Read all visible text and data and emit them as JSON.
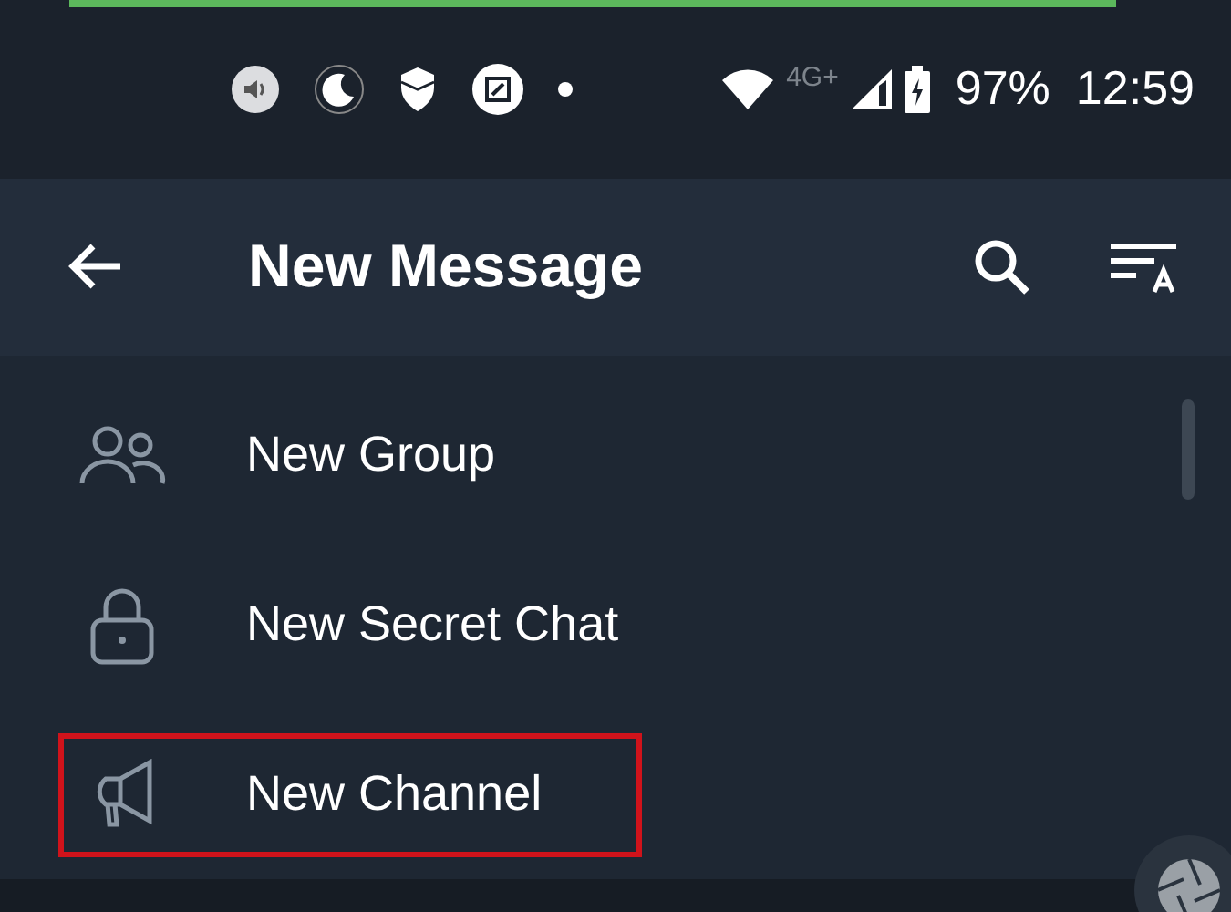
{
  "status_bar": {
    "network": "4G+",
    "battery": "97%",
    "time": "12:59"
  },
  "header": {
    "title": "New Message"
  },
  "items": [
    {
      "label": "New Group",
      "kind": "group",
      "highlighted": false
    },
    {
      "label": "New Secret Chat",
      "kind": "lock",
      "highlighted": false
    },
    {
      "label": "New Channel",
      "kind": "megaphone",
      "highlighted": true
    }
  ]
}
